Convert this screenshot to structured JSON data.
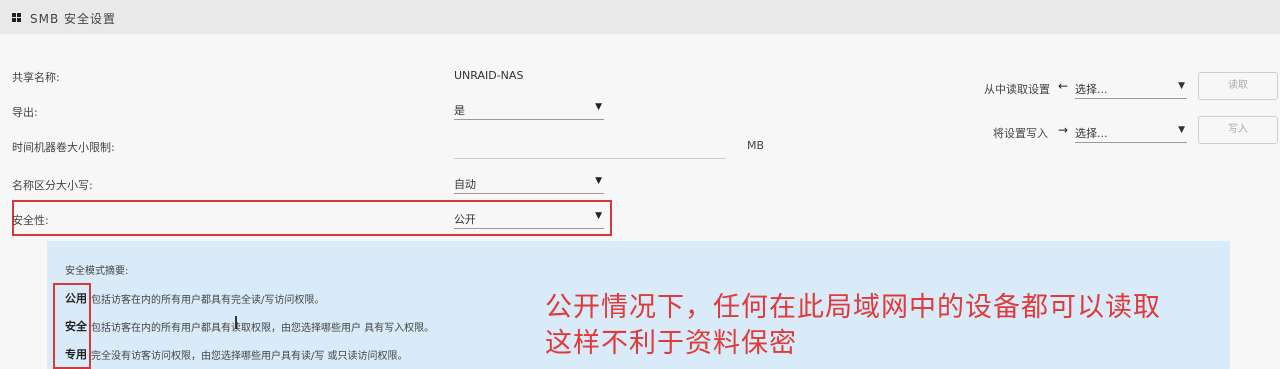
{
  "header": {
    "title": "SMB 安全设置",
    "icon": "windows-icon"
  },
  "form": {
    "share_name_label": "共享名称:",
    "share_name_value": "UNRAID-NAS",
    "export_label": "导出:",
    "export_value": "是",
    "tm_label": "时间机器卷大小限制:",
    "tm_value": "",
    "tm_unit": "MB",
    "case_label": "名称区分大小写:",
    "case_value": "自动",
    "security_label": "安全性:",
    "security_value": "公开"
  },
  "right": {
    "read_label": "从中读取设置",
    "read_select": "选择...",
    "read_button": "读取",
    "write_label": "将设置写入",
    "write_select": "选择...",
    "write_button": "写入"
  },
  "summary": {
    "title": "安全模式摘要:",
    "rows": [
      {
        "mode": "公用",
        "desc": "包括访客在内的所有用户都具有完全读/写访问权限。"
      },
      {
        "mode": "安全",
        "desc": "包括访客在内的所有用户都具有读取权限，由您选择哪些用户 具有写入权限。"
      },
      {
        "mode": "专用",
        "desc": "完全没有访客访问权限，由您选择哪些用户具有读/写 或只读访问权限。"
      }
    ]
  },
  "annotation": {
    "line1": "公开情况下，任何在此局域网中的设备都可以读取",
    "line2": "这样不利于资料保密"
  },
  "colors": {
    "accent_red": "#d43a3a",
    "panel_bg": "#d9ebf8",
    "annotation_red": "#e03a3a"
  }
}
